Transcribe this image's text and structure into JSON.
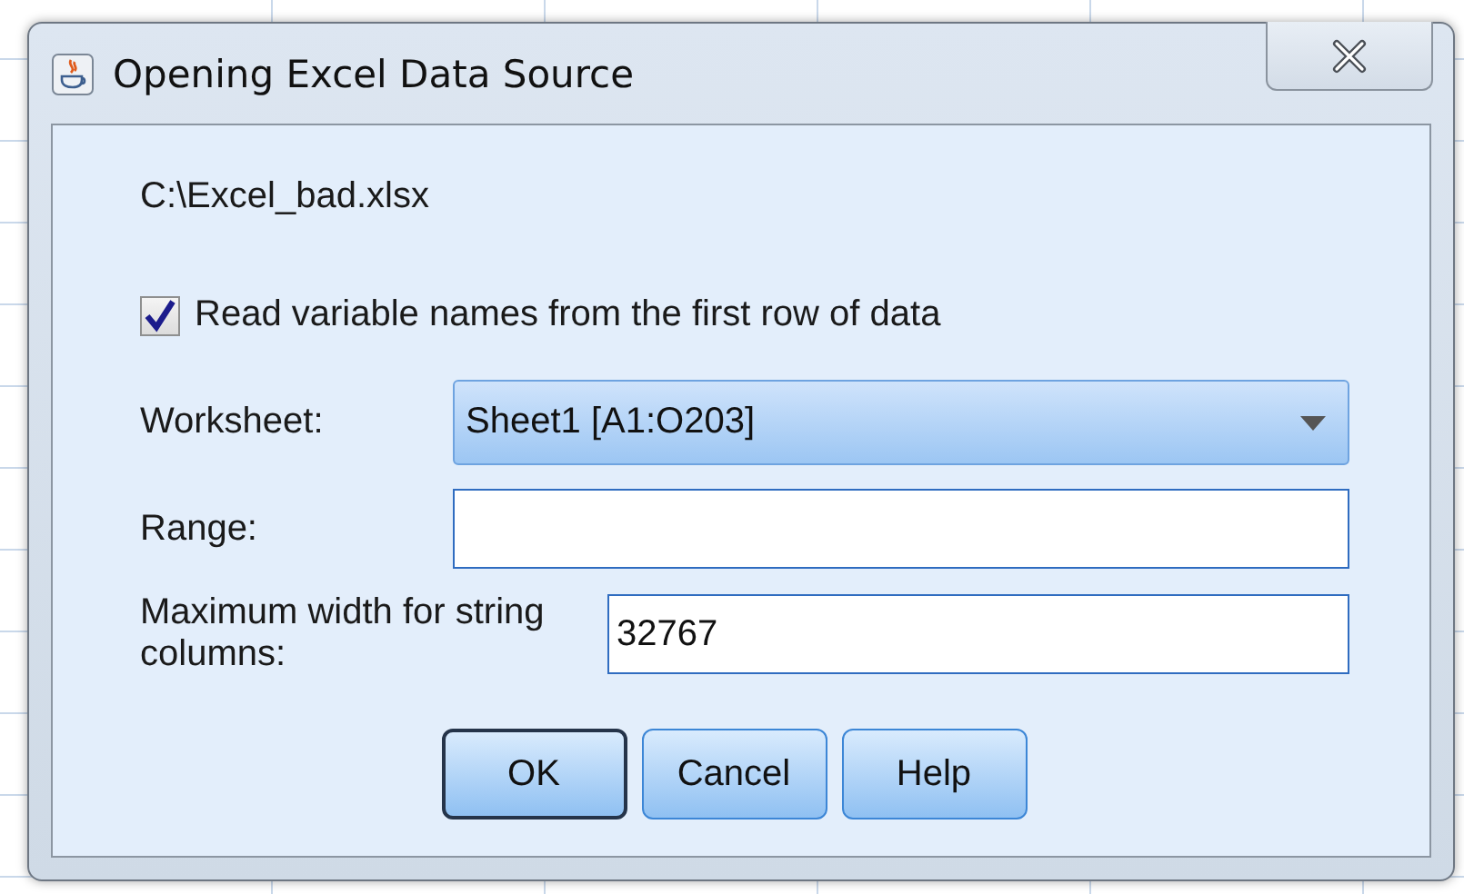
{
  "window": {
    "title": "Opening Excel Data Source"
  },
  "file_path": "C:\\Excel_bad.xlsx",
  "first_row_checkbox": {
    "label": "Read variable names from the first row of data",
    "checked": true
  },
  "worksheet": {
    "label": "Worksheet:",
    "value": "Sheet1 [A1:O203]"
  },
  "range": {
    "label": "Range:"
  },
  "max_width": {
    "label": "Maximum width for string columns:",
    "value": "32767"
  },
  "buttons": [
    {
      "label": "OK",
      "default": true
    },
    {
      "label": "Cancel",
      "default": false
    },
    {
      "label": "Help",
      "default": false
    }
  ]
}
